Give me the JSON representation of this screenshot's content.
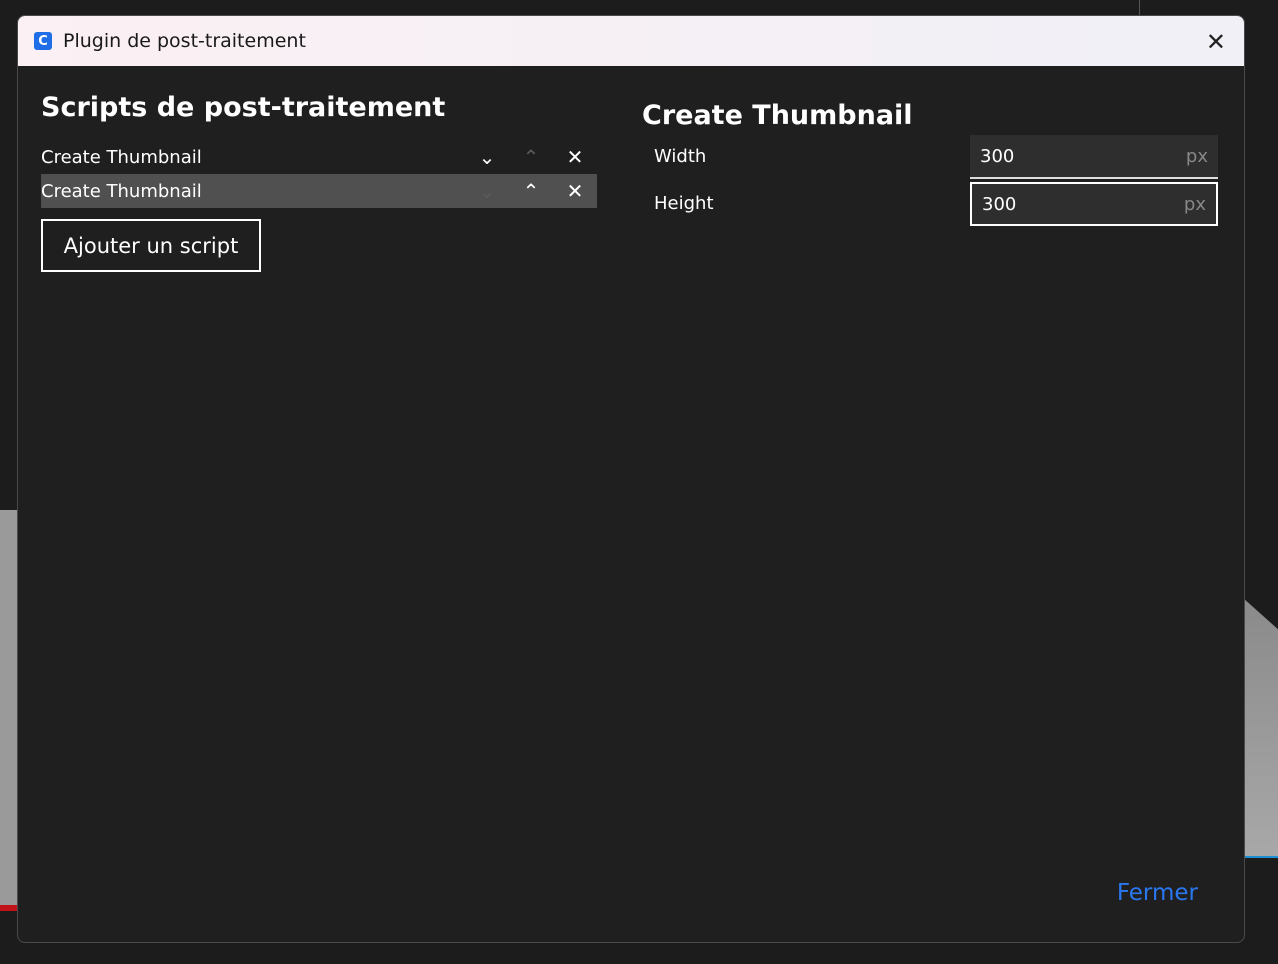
{
  "window": {
    "title": "Plugin de post-traitement",
    "close_icon": "close-icon"
  },
  "left": {
    "heading": "Scripts de post-traitement",
    "scripts": [
      {
        "label": "Create Thumbnail"
      },
      {
        "label": "Create Thumbnail"
      }
    ],
    "add_button": "Ajouter un script"
  },
  "right": {
    "heading": "Create Thumbnail",
    "fields": [
      {
        "label": "Width",
        "value": "300",
        "unit": "px"
      },
      {
        "label": "Height",
        "value": "300",
        "unit": "px"
      }
    ]
  },
  "footer": {
    "close_label": "Fermer"
  },
  "colors": {
    "accent": "#2a78f0",
    "selected_row": "#505050"
  }
}
